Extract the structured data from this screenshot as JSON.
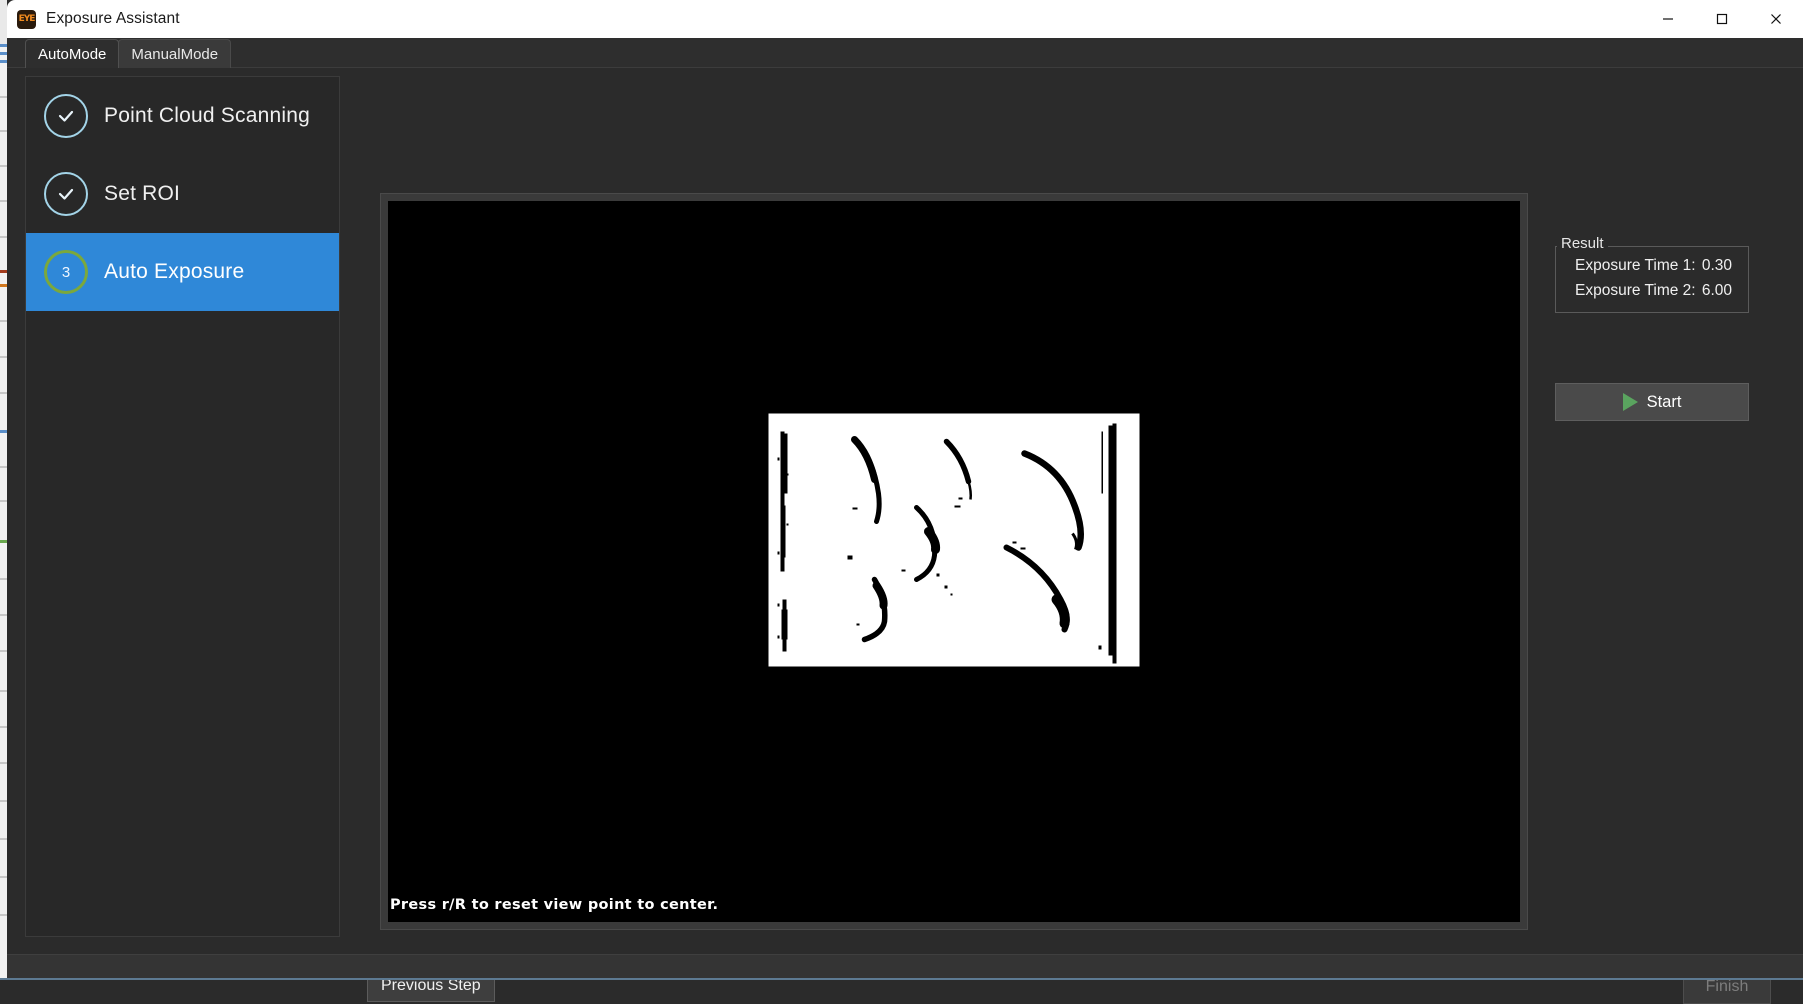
{
  "window": {
    "title": "Exposure Assistant",
    "icon": "eye-app-icon",
    "controls": {
      "minimize": "minimize-icon",
      "maximize": "maximize-icon",
      "close": "close-icon"
    }
  },
  "tabs": [
    {
      "label": "AutoMode",
      "active": true
    },
    {
      "label": "ManualMode",
      "active": false
    }
  ],
  "sidebar": {
    "steps": [
      {
        "index": "1",
        "label": "Point Cloud Scanning",
        "state": "done",
        "icon": "check-icon"
      },
      {
        "index": "2",
        "label": "Set ROI",
        "state": "done",
        "icon": "check-icon"
      },
      {
        "index": "3",
        "label": "Auto Exposure",
        "state": "current",
        "icon": "step-number"
      }
    ]
  },
  "viewport": {
    "hint": "Press r/R to reset view point to center.",
    "content": "binarized-point-cloud-depth-map",
    "background_color": "#000000"
  },
  "right_panel": {
    "result": {
      "legend": "Result",
      "rows": [
        {
          "label": "Exposure Time 1:",
          "value": "0.30"
        },
        {
          "label": "Exposure Time 2:",
          "value": "6.00"
        }
      ]
    },
    "start_button": {
      "label": "Start",
      "icon": "play-icon"
    }
  },
  "footer": {
    "previous_label": "Previous Step",
    "finish_label": "Finish",
    "finish_enabled": false
  },
  "colors": {
    "accent_blue": "#2f88d8",
    "step_done_ring": "#a3d4e8",
    "step_current_ring": "#7ba83c",
    "play_green": "#5aa45f",
    "window_bg": "#2b2b2b",
    "panel_bg": "#282828",
    "titlebar_bg": "#ffffff"
  }
}
